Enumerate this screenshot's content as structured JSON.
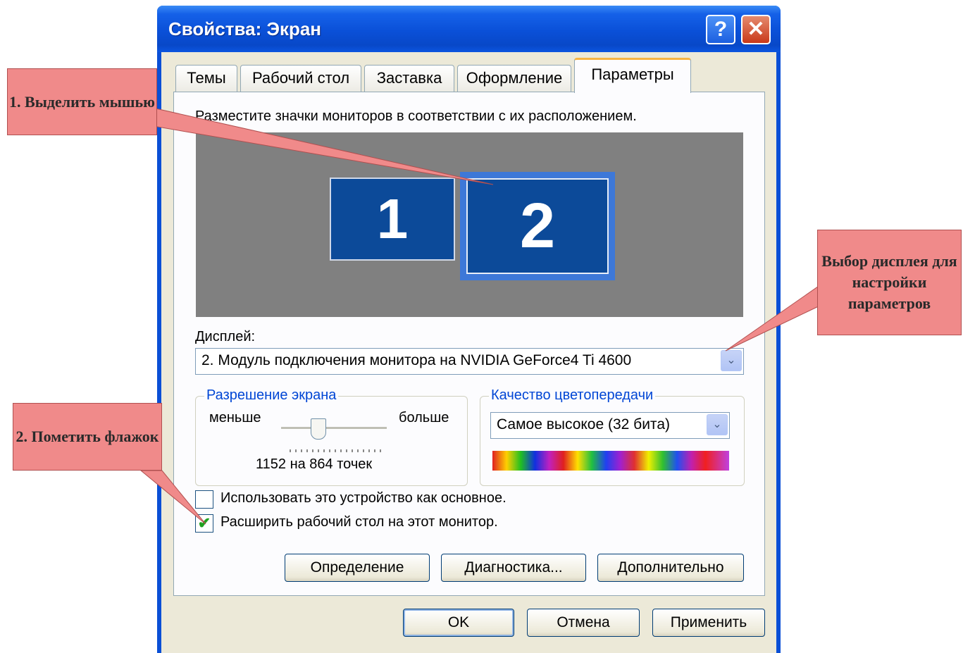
{
  "window": {
    "title": "Свойства: Экран",
    "help_icon_glyph": "?",
    "close_icon_glyph": "✕"
  },
  "tabs": [
    {
      "label": "Темы"
    },
    {
      "label": "Рабочий стол"
    },
    {
      "label": "Заставка"
    },
    {
      "label": "Оформление"
    },
    {
      "label": "Параметры",
      "active": true
    }
  ],
  "settings": {
    "instruction": "Разместите значки мониторов в соответствии с их расположением.",
    "monitors": [
      {
        "number": "1",
        "selected": false
      },
      {
        "number": "2",
        "selected": true
      }
    ],
    "display_label": "Дисплей:",
    "display_value": "2. Модуль подключения монитора на NVIDIA GeForce4 Ti 4600",
    "resolution": {
      "group_title": "Разрешение экрана",
      "less_label": "меньше",
      "more_label": "больше",
      "value_text": "1152 на 864 точек"
    },
    "color_quality": {
      "group_title": "Качество цветопередачи",
      "selected": "Самое высокое (32 бита)"
    },
    "checkboxes": [
      {
        "label": "Использовать это устройство как основное.",
        "checked": false
      },
      {
        "label": "Расширить рабочий стол на этот монитор.",
        "checked": true
      }
    ],
    "check_glyph": "✔",
    "dropdown_glyph": "⌄",
    "buttons": {
      "identify": "Определение",
      "troubleshoot": "Диагностика...",
      "advanced": "Дополнительно"
    }
  },
  "dialog_buttons": {
    "ok": "OK",
    "cancel": "Отмена",
    "apply": "Применить"
  },
  "annotations": {
    "callout_1": "1. Выделить мышью",
    "callout_2": "2. Пометить флажок",
    "callout_3": "Выбор дисплея для настройки параметров",
    "color": "#f08a8a"
  },
  "colors": {
    "title_bar": "#0a50d8",
    "monitor_fill": "#0c4a99",
    "monitor_area": "#808080",
    "group_title": "#0046d5",
    "active_tab_accent": "#f7b442"
  }
}
